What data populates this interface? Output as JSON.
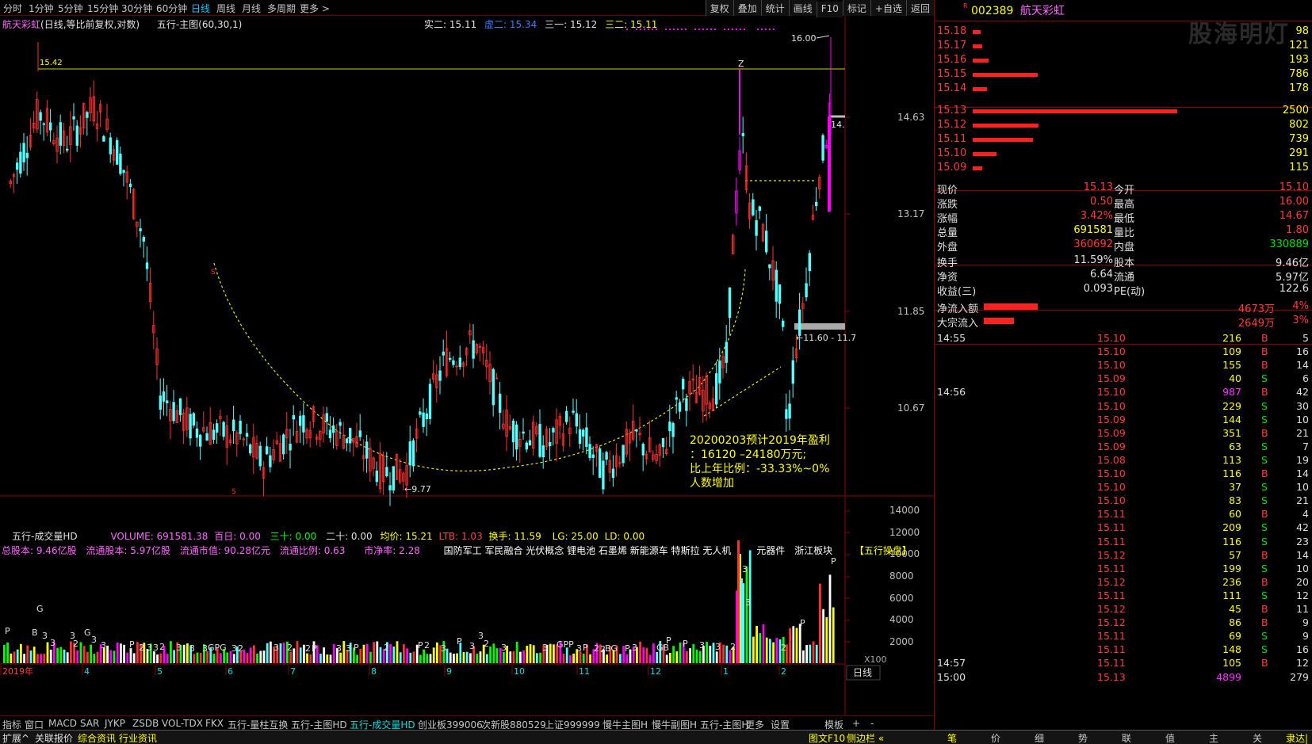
{
  "topbar": {
    "periods": [
      "分时",
      "1分钟",
      "5分钟",
      "15分钟",
      "30分钟",
      "60分钟",
      "日线",
      "周线",
      "月线",
      "多周期",
      "更多 >"
    ],
    "active_period": "日线",
    "tools": [
      "复权",
      "叠加",
      "统计",
      "画线",
      "F10",
      "标记",
      "+自选",
      "返回"
    ]
  },
  "chart": {
    "title": "航天彩虹",
    "subtitle": "(日线,等比前复权,对数)",
    "indicator": "五行-主图(60,30,1)",
    "legend": {
      "shi2": "实二: 15.11",
      "xu2": "虚二: 15.34",
      "san1": "三一: 15.12",
      "san2": "三二: 15.11"
    },
    "y_axis_labels": [
      "14.63",
      "13.17",
      "11.85",
      "10.67"
    ],
    "high_label": "15.42",
    "peak_label": "16.00",
    "peak_marker": "Z",
    "low_label": "9.77",
    "current_label": "14.",
    "range_label": "11.60 - 11.7",
    "s_marker": "S",
    "annotation": [
      "20200203预计2019年盈利",
      "：16120 –24180万元;",
      "比上年比例：-33.33%~0%",
      "人数增加"
    ],
    "month_labels": [
      "2019年",
      "4",
      "5",
      "6",
      "7",
      "8",
      "9",
      "10",
      "11",
      "12",
      "1",
      "2"
    ],
    "colors": {
      "up": "#ff3232",
      "down": "#54ffff",
      "magenta": "#ff00ff",
      "ref_line": "#d4d400",
      "curve": "#e8e800"
    }
  },
  "volume": {
    "title": "五行-成交量HD",
    "stats": {
      "volume": "VOLUME: 691581.38",
      "bairi": "百日: 0.00",
      "sanshi": "三十: 0.00",
      "ershi": "二十: 0.00",
      "junjia": "均价: 15.21",
      "ltb": "LTB: 1.03",
      "huanshou": "换手: 11.59",
      "lg": "LG: 25.00",
      "ld": "LD: 0.00"
    },
    "info": {
      "zgb": "总股本: 9.46亿股",
      "ltgb": "流通股本: 5.97亿股",
      "ltsz": "流通市值: 90.28亿元",
      "ltbl": "流通比例: 0.63",
      "sjl": "市净率: 2.28",
      "concepts": "国防军工 军民融合 光伏概念 锂电池 石墨烯 新能源车 特斯拉 无人机",
      "yqj": "元器件",
      "zjbk": "浙江板块",
      "wxcp": "【五行操盘】"
    },
    "y_axis_labels": [
      "14000",
      "12000",
      "10000",
      "8000",
      "6000",
      "4000",
      "2000"
    ],
    "unit": "X100"
  },
  "bottom_tabs": [
    "指标",
    "窗口",
    "MACD",
    "SAR",
    "JYKP",
    "ZSDB",
    "VOL-TDX",
    "FKX",
    "五行-量柱互换",
    "五行-主图HD",
    "五行-成交量HD",
    "创业板399006",
    "次新股880529",
    "上证999999",
    "慢牛主图H",
    "慢牛副图H",
    "五行-主图H",
    "更多",
    "设置"
  ],
  "bottom_right": [
    "模板",
    "+",
    "-"
  ],
  "day_button": "日线",
  "statusbar": {
    "left": [
      "扩展^",
      "关联报价",
      "综合资讯",
      "行业资讯"
    ],
    "right": [
      "图文F10",
      "侧边栏 «"
    ],
    "quote_tabs": [
      "笔",
      "价",
      "细",
      "势",
      "联",
      "值",
      "主",
      "关"
    ],
    "corner": "隶达|"
  },
  "quote": {
    "r_badge": "R",
    "code": "002389",
    "name": "航天彩虹",
    "watermark": "股海明灯",
    "asks": [
      {
        "price": "15.18",
        "vol": "98",
        "len": 10
      },
      {
        "price": "15.17",
        "vol": "121",
        "len": 12
      },
      {
        "price": "15.16",
        "vol": "193",
        "len": 20
      },
      {
        "price": "15.15",
        "vol": "786",
        "len": 82
      },
      {
        "price": "15.14",
        "vol": "178",
        "len": 18
      }
    ],
    "bids": [
      {
        "price": "15.13",
        "vol": "2500",
        "len": 258
      },
      {
        "price": "15.12",
        "vol": "802",
        "len": 83
      },
      {
        "price": "15.11",
        "vol": "739",
        "len": 76
      },
      {
        "price": "15.10",
        "vol": "291",
        "len": 30
      },
      {
        "price": "15.09",
        "vol": "115",
        "len": 12
      }
    ],
    "stats": [
      {
        "l1": "现价",
        "v1": "15.13",
        "c1": "red",
        "l2": "今开",
        "v2": "15.10",
        "c2": "red"
      },
      {
        "l1": "涨跌",
        "v1": "0.50",
        "c1": "red",
        "l2": "最高",
        "v2": "16.00",
        "c2": "red"
      },
      {
        "l1": "涨幅",
        "v1": "3.42%",
        "c1": "red",
        "l2": "最低",
        "v2": "14.67",
        "c2": "red"
      },
      {
        "l1": "总量",
        "v1": "691581",
        "c1": "yel",
        "l2": "量比",
        "v2": "1.80",
        "c2": "red"
      },
      {
        "l1": "外盘",
        "v1": "360692",
        "c1": "red",
        "l2": "内盘",
        "v2": "330889",
        "c2": "grn"
      }
    ],
    "stats2": [
      {
        "l1": "换手",
        "v1": "11.59%",
        "l2": "股本",
        "v2": "9.46亿"
      },
      {
        "l1": "净资",
        "v1": "6.64",
        "l2": "流通",
        "v2": "5.97亿"
      },
      {
        "l1": "收益(三)",
        "v1": "0.093",
        "l2": "PE(动)",
        "v2": "122.6"
      }
    ],
    "flows": [
      {
        "label": "净流入额",
        "value": "4673万",
        "pct": "4%",
        "len": 68
      },
      {
        "label": "大宗流入",
        "value": "2649万",
        "pct": "3%",
        "len": 38
      }
    ],
    "ticks": [
      {
        "t": "14:55",
        "p": "15.10",
        "v": "216",
        "s": "B",
        "n": "5",
        "vc": "yel"
      },
      {
        "t": "",
        "p": "15.10",
        "v": "109",
        "s": "B",
        "n": "16",
        "vc": "yel"
      },
      {
        "t": "",
        "p": "15.10",
        "v": "155",
        "s": "B",
        "n": "14",
        "vc": "yel"
      },
      {
        "t": "",
        "p": "15.09",
        "v": "40",
        "s": "S",
        "n": "6",
        "vc": "yel"
      },
      {
        "t": "14:56",
        "p": "15.10",
        "v": "987",
        "s": "B",
        "n": "42",
        "vc": "mag"
      },
      {
        "t": "",
        "p": "15.10",
        "v": "229",
        "s": "S",
        "n": "30",
        "vc": "yel"
      },
      {
        "t": "",
        "p": "15.09",
        "v": "144",
        "s": "S",
        "n": "10",
        "vc": "yel"
      },
      {
        "t": "",
        "p": "15.09",
        "v": "351",
        "s": "B",
        "n": "21",
        "vc": "yel"
      },
      {
        "t": "",
        "p": "15.09",
        "v": "63",
        "s": "S",
        "n": "7",
        "vc": "yel"
      },
      {
        "t": "",
        "p": "15.08",
        "v": "113",
        "s": "S",
        "n": "19",
        "vc": "yel"
      },
      {
        "t": "",
        "p": "15.10",
        "v": "116",
        "s": "B",
        "n": "14",
        "vc": "yel"
      },
      {
        "t": "",
        "p": "15.10",
        "v": "37",
        "s": "S",
        "n": "10",
        "vc": "yel"
      },
      {
        "t": "",
        "p": "15.10",
        "v": "83",
        "s": "S",
        "n": "21",
        "vc": "yel"
      },
      {
        "t": "",
        "p": "15.11",
        "v": "60",
        "s": "B",
        "n": "4",
        "vc": "yel"
      },
      {
        "t": "",
        "p": "15.11",
        "v": "209",
        "s": "S",
        "n": "42",
        "vc": "yel"
      },
      {
        "t": "",
        "p": "15.11",
        "v": "116",
        "s": "S",
        "n": "23",
        "vc": "yel"
      },
      {
        "t": "",
        "p": "15.12",
        "v": "57",
        "s": "B",
        "n": "14",
        "vc": "yel"
      },
      {
        "t": "",
        "p": "15.11",
        "v": "199",
        "s": "S",
        "n": "10",
        "vc": "yel"
      },
      {
        "t": "",
        "p": "15.12",
        "v": "236",
        "s": "B",
        "n": "20",
        "vc": "yel"
      },
      {
        "t": "",
        "p": "15.11",
        "v": "111",
        "s": "S",
        "n": "12",
        "vc": "yel"
      },
      {
        "t": "",
        "p": "15.12",
        "v": "45",
        "s": "B",
        "n": "11",
        "vc": "yel"
      },
      {
        "t": "",
        "p": "15.12",
        "v": "86",
        "s": "B",
        "n": "9",
        "vc": "yel"
      },
      {
        "t": "",
        "p": "15.11",
        "v": "69",
        "s": "S",
        "n": "9",
        "vc": "yel"
      },
      {
        "t": "",
        "p": "15.11",
        "v": "148",
        "s": "S",
        "n": "16",
        "vc": "yel"
      },
      {
        "t": "14:57",
        "p": "15.11",
        "v": "105",
        "s": "B",
        "n": "12",
        "vc": "yel"
      },
      {
        "t": "15:00",
        "p": "15.13",
        "v": "4899",
        "s": "",
        "n": "279",
        "vc": "mag"
      }
    ]
  }
}
